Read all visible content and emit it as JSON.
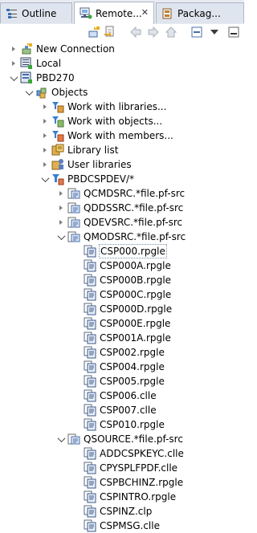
{
  "tabs": [
    {
      "label": "Outline",
      "icon": "outline-icon",
      "active": false
    },
    {
      "label": "Remote...",
      "icon": "remote-systems-icon",
      "active": true
    },
    {
      "label": "Packag...",
      "icon": "package-explorer-icon",
      "active": false
    }
  ],
  "toolbar": {
    "buttons": [
      "new-connection-icon",
      "link-editor-icon",
      "back-icon",
      "forward-icon",
      "home-icon",
      "collapse-all-icon",
      "view-menu-icon",
      "minimize-icon"
    ]
  },
  "tree": {
    "new_connection": "New Connection",
    "local": "Local",
    "system": "PBD270",
    "objects": "Objects",
    "work_libraries": "Work with libraries...",
    "work_objects": "Work with objects...",
    "work_members": "Work with members...",
    "library_list": "Library list",
    "user_libraries": "User libraries",
    "filter": "PBDCSPDEV/*",
    "files": [
      {
        "label": "QCMDSRC.*file.pf-src"
      },
      {
        "label": "QDDSSRC.*file.pf-src"
      },
      {
        "label": "QDEVSRC.*file.pf-src"
      },
      {
        "label": "QMODSRC.*file.pf-src"
      },
      {
        "label": "QSOURCE.*file.pf-src"
      }
    ],
    "qmodsrc_members": [
      "CSP000.rpgle",
      "CSP000A.rpgle",
      "CSP000B.rpgle",
      "CSP000C.rpgle",
      "CSP000D.rpgle",
      "CSP000E.rpgle",
      "CSP001A.rpgle",
      "CSP002.rpgle",
      "CSP004.rpgle",
      "CSP005.rpgle",
      "CSP006.clle",
      "CSP007.clle",
      "CSP010.rpgle"
    ],
    "qsource_members": [
      "ADDCSPKEYC.clle",
      "CPYSPLFPDF.clle",
      "CSPBCHINZ.rpgle",
      "CSPINTRO.rpgle",
      "CSPINZ.clp",
      "CSPMSG.clle"
    ]
  }
}
